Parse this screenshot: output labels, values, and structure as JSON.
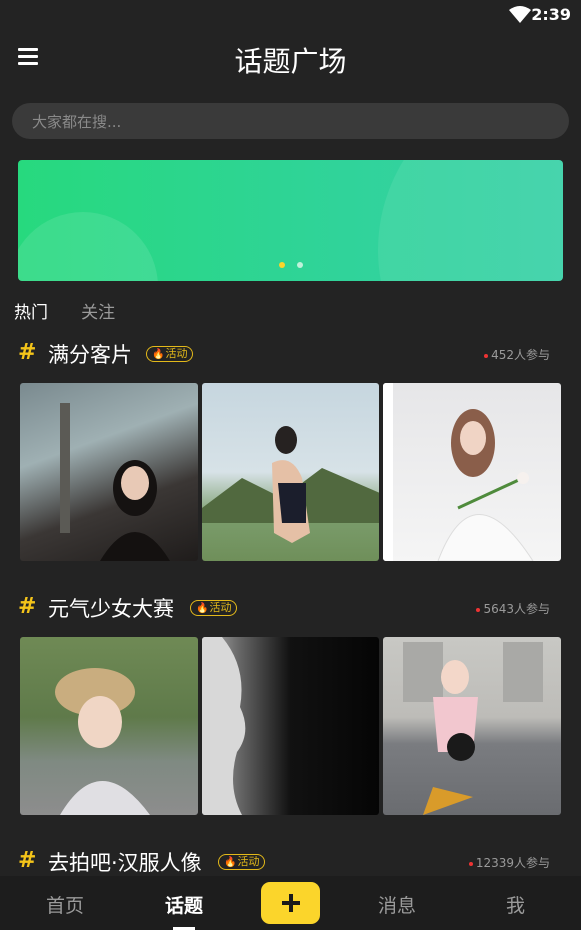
{
  "status": {
    "time": "2:39"
  },
  "header": {
    "title": "话题广场"
  },
  "search": {
    "placeholder": "大家都在搜..."
  },
  "feed_tabs": [
    {
      "label": "热门",
      "active": true
    },
    {
      "label": "关注",
      "active": false
    }
  ],
  "topics": [
    {
      "name": "满分客片",
      "badge": "活动",
      "participants": "452人参与"
    },
    {
      "name": "元气少女大赛",
      "badge": "活动",
      "participants": "5643人参与"
    },
    {
      "name": "去拍吧·汉服人像",
      "badge": "活动",
      "participants": "12339人参与"
    }
  ],
  "bottom_nav": {
    "home": "首页",
    "topics": "话题",
    "add": "+",
    "messages": "消息",
    "me": "我"
  },
  "colors": {
    "accent": "#fbd52b",
    "hash": "#f4c41a",
    "banner": "#2fd58e",
    "background": "#232323"
  }
}
